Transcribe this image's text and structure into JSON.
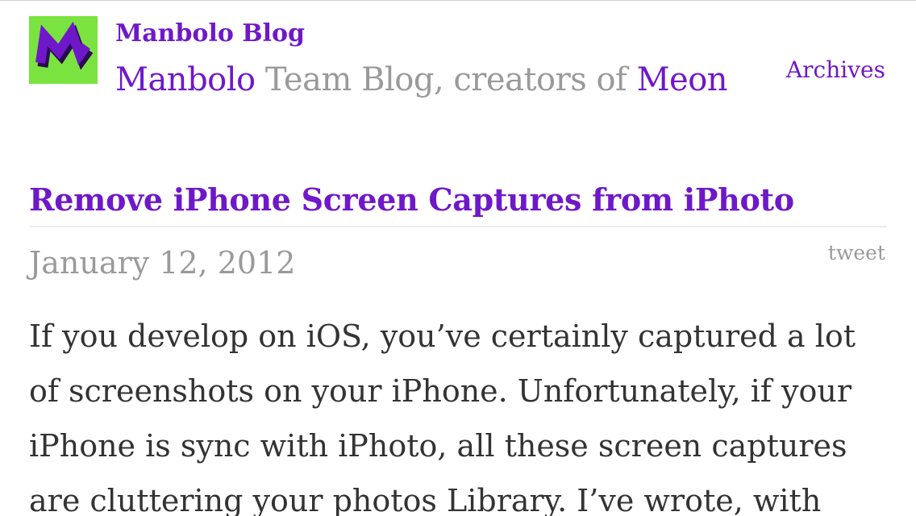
{
  "header": {
    "blog_name": "Manbolo Blog",
    "tagline": {
      "part1": "Manbolo",
      "part2": " Team Blog, creators of ",
      "part3": "Meon"
    },
    "archives_label": "Archives",
    "logo_icon": "manbolo-m-logo-icon"
  },
  "post": {
    "title": "Remove iPhone Screen Captures from iPhoto",
    "date": "January 12, 2012",
    "tweet_label": "tweet",
    "body_lines": [
      "If you develop on iOS, you’ve certainly captured a lot",
      "of screenshots on your iPhone. Unfortunately, if your",
      "iPhone is sync with iPhoto, all these screen captures",
      "are cluttering your photos Library. I’ve wrote, with"
    ]
  },
  "colors": {
    "accent": "#6f18c9",
    "muted": "#9a9a9a",
    "body_text": "#333333",
    "logo_bg": "#7be33f"
  }
}
